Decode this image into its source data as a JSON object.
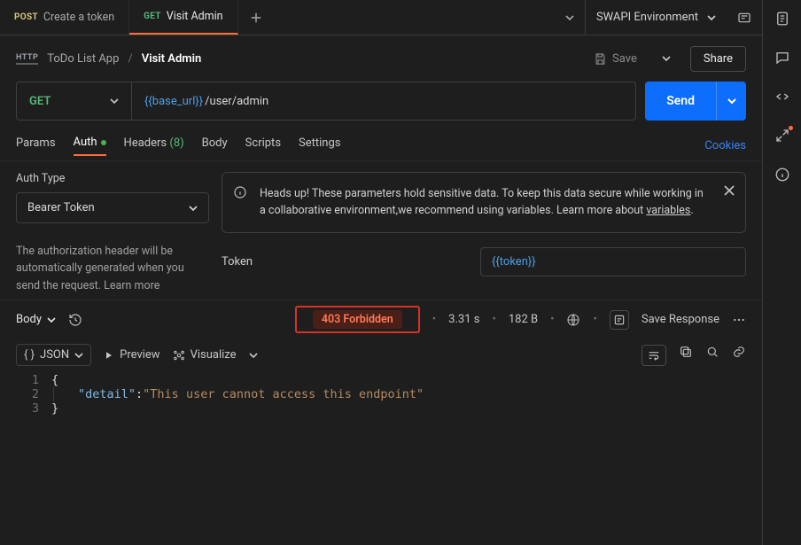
{
  "tabs": [
    {
      "method": "POST",
      "label": "Create a token"
    },
    {
      "method": "GET",
      "label": "Visit Admin"
    }
  ],
  "environment": {
    "name": "SWAPI Environment"
  },
  "breadcrumb": {
    "protocol": "HTTP",
    "collection": "ToDo List App",
    "request": "Visit Admin"
  },
  "header_actions": {
    "save": "Save",
    "share": "Share"
  },
  "url_bar": {
    "method": "GET",
    "variable": "{{base_url}}",
    "path": "/user/admin",
    "send": "Send"
  },
  "subtabs": {
    "params": "Params",
    "auth": "Auth",
    "headers": "Headers",
    "headers_count": "(8)",
    "body": "Body",
    "scripts": "Scripts",
    "settings": "Settings",
    "cookies": "Cookies"
  },
  "auth": {
    "type_label": "Auth Type",
    "type_value": "Bearer Token",
    "help_text": "The authorization header will be automatically generated when you send the request. Learn more",
    "banner_prefix": "Heads up! These parameters hold sensitive data. To keep this data secure while working in a collaborative environment,we recommend using variables. Learn more about ",
    "banner_link": "variables",
    "token_label": "Token",
    "token_value": "{{token}}"
  },
  "response_meta": {
    "tab": "Body",
    "status": "403 Forbidden",
    "time": "3.31 s",
    "size": "182 B",
    "save_response": "Save Response"
  },
  "response_toolbar": {
    "format": "JSON",
    "preview": "Preview",
    "visualize": "Visualize"
  },
  "response_body": {
    "lines": [
      "1",
      "2",
      "3"
    ],
    "open_brace": "{",
    "key": "\"detail\"",
    "colon": ": ",
    "value": "\"This user cannot access this endpoint\"",
    "close_brace": "}"
  }
}
